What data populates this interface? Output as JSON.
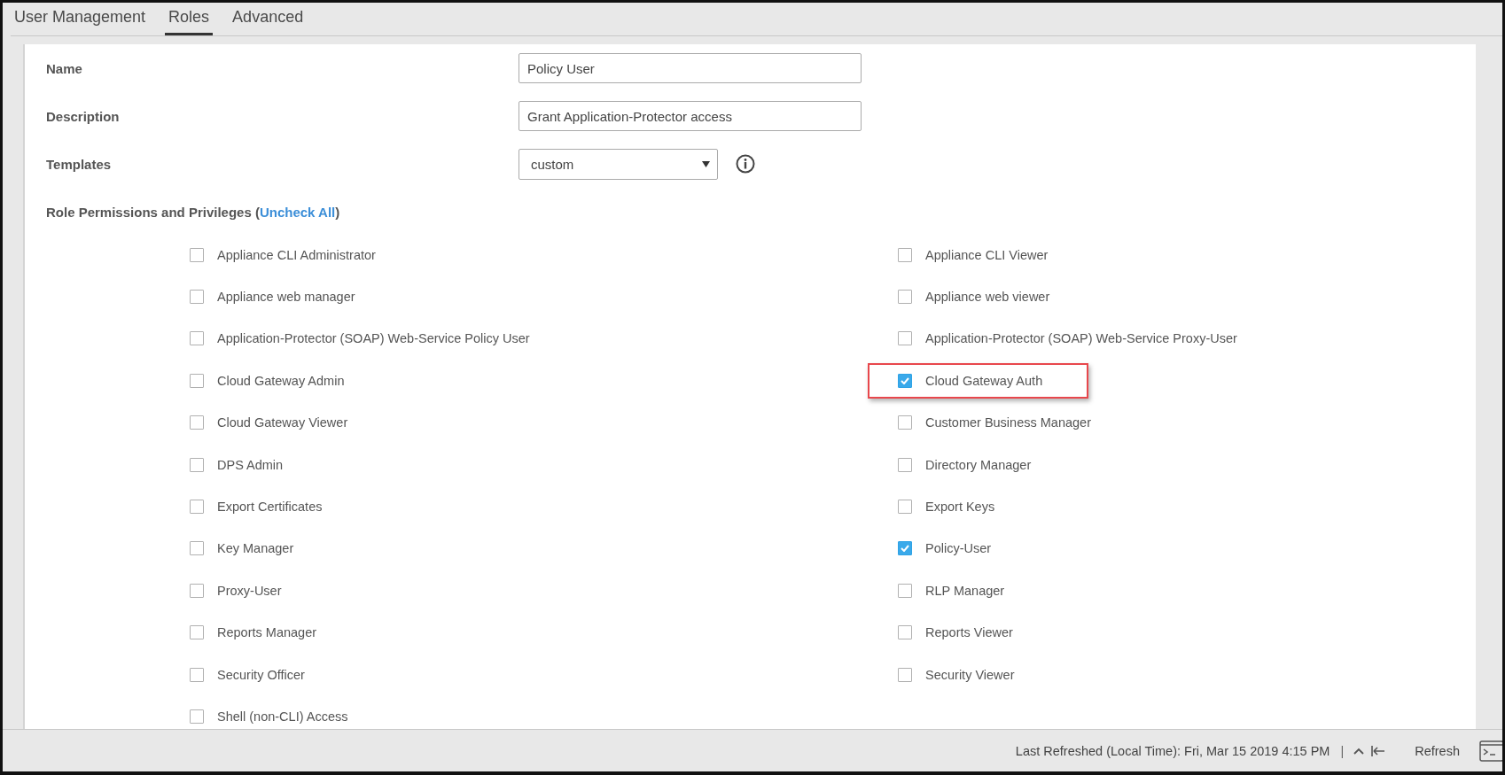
{
  "tabs": [
    {
      "label": "User Management",
      "selected": false
    },
    {
      "label": "Roles",
      "selected": true
    },
    {
      "label": "Advanced",
      "selected": false
    }
  ],
  "form": {
    "name": {
      "label": "Name",
      "value": "Policy User"
    },
    "description": {
      "label": "Description",
      "value": "Grant Application-Protector access"
    },
    "templates": {
      "label": "Templates",
      "value": "custom"
    },
    "permissions_heading": {
      "label": "Role Permissions and Privileges (",
      "link": "Uncheck All",
      "close": ")"
    }
  },
  "permissions": [
    {
      "label": "Appliance CLI Administrator",
      "checked": false,
      "highlighted": false
    },
    {
      "label": "Appliance CLI Viewer",
      "checked": false,
      "highlighted": false
    },
    {
      "label": "Appliance web manager",
      "checked": false,
      "highlighted": false
    },
    {
      "label": "Appliance web viewer",
      "checked": false,
      "highlighted": false
    },
    {
      "label": "Application-Protector (SOAP) Web-Service Policy User",
      "checked": false,
      "highlighted": false
    },
    {
      "label": "Application-Protector (SOAP) Web-Service Proxy-User",
      "checked": false,
      "highlighted": false
    },
    {
      "label": "Cloud Gateway Admin",
      "checked": false,
      "highlighted": false
    },
    {
      "label": "Cloud Gateway Auth",
      "checked": true,
      "highlighted": true
    },
    {
      "label": "Cloud Gateway Viewer",
      "checked": false,
      "highlighted": false
    },
    {
      "label": "Customer Business Manager",
      "checked": false,
      "highlighted": false
    },
    {
      "label": "DPS Admin",
      "checked": false,
      "highlighted": false
    },
    {
      "label": "Directory Manager",
      "checked": false,
      "highlighted": false
    },
    {
      "label": "Export Certificates",
      "checked": false,
      "highlighted": false
    },
    {
      "label": "Export Keys",
      "checked": false,
      "highlighted": false
    },
    {
      "label": "Key Manager",
      "checked": false,
      "highlighted": false
    },
    {
      "label": "Policy-User",
      "checked": true,
      "highlighted": false
    },
    {
      "label": "Proxy-User",
      "checked": false,
      "highlighted": false
    },
    {
      "label": "RLP Manager",
      "checked": false,
      "highlighted": false
    },
    {
      "label": "Reports Manager",
      "checked": false,
      "highlighted": false
    },
    {
      "label": "Reports Viewer",
      "checked": false,
      "highlighted": false
    },
    {
      "label": "Security Officer",
      "checked": false,
      "highlighted": false
    },
    {
      "label": "Security Viewer",
      "checked": false,
      "highlighted": false
    },
    {
      "label": "Shell (non-CLI) Access",
      "checked": false,
      "highlighted": false
    }
  ],
  "status_bar": {
    "last_refreshed": "Last Refreshed (Local Time): Fri, Mar 15 2019 4:15 PM",
    "separator": "|",
    "refresh": "Refresh"
  }
}
